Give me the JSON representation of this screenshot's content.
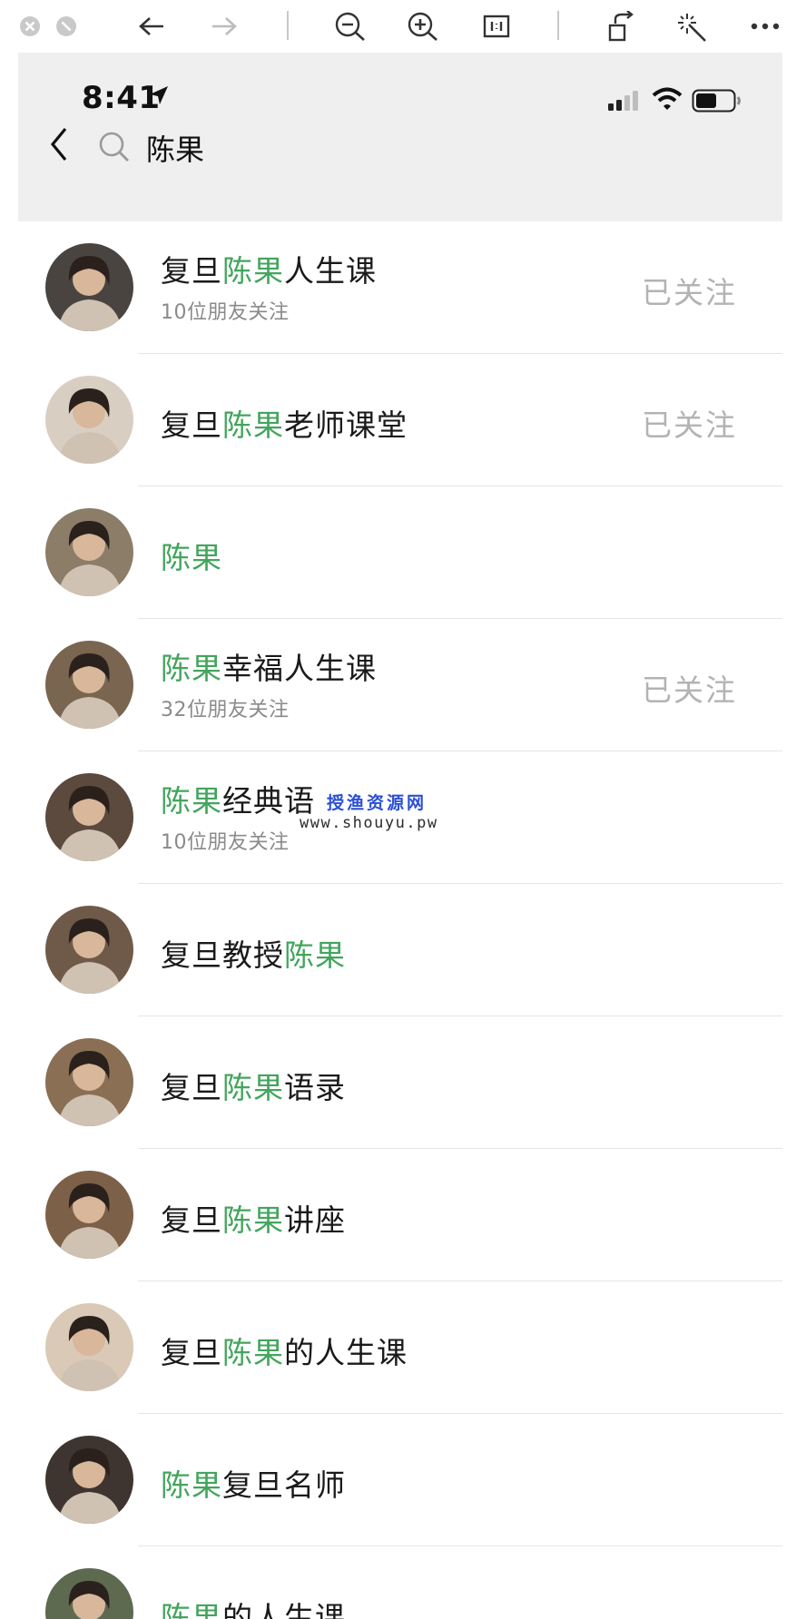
{
  "viewer_toolbar": {
    "icons": [
      "close-icon",
      "minimize-icon",
      "back-arrow-icon",
      "forward-arrow-icon",
      "zoom-out-icon",
      "zoom-in-icon",
      "actual-size-icon",
      "rotate-icon",
      "magic-wand-icon",
      "more-icon"
    ]
  },
  "status_bar": {
    "time": "8:41"
  },
  "search": {
    "query": "陈果"
  },
  "results": [
    {
      "pre": "复旦",
      "hl": "陈果",
      "post": "人生课",
      "sub": "10位朋友关注",
      "action": "已关注",
      "avatar_color": "#4a4440"
    },
    {
      "pre": "复旦",
      "hl": "陈果",
      "post": "老师课堂",
      "sub": "",
      "action": "已关注",
      "avatar_color": "#d8cfc2"
    },
    {
      "pre": "",
      "hl": "陈果",
      "post": "",
      "sub": "",
      "action": "",
      "avatar_color": "#8c7d68"
    },
    {
      "pre": "",
      "hl": "陈果",
      "post": "幸福人生课",
      "sub": "32位朋友关注",
      "action": "已关注",
      "avatar_color": "#7a6550"
    },
    {
      "pre": "",
      "hl": "陈果",
      "post": "经典语",
      "sub": "10位朋友关注",
      "action": "",
      "avatar_color": "#5b4a3d"
    },
    {
      "pre": "复旦教授",
      "hl": "陈果",
      "post": "",
      "sub": "",
      "action": "",
      "avatar_color": "#6f5a4a"
    },
    {
      "pre": "复旦",
      "hl": "陈果",
      "post": "语录",
      "sub": "",
      "action": "",
      "avatar_color": "#8a6f55"
    },
    {
      "pre": "复旦",
      "hl": "陈果",
      "post": "讲座",
      "sub": "",
      "action": "",
      "avatar_color": "#7d6048"
    },
    {
      "pre": "复旦",
      "hl": "陈果",
      "post": "的人生课",
      "sub": "",
      "action": "",
      "avatar_color": "#d9c9b6"
    },
    {
      "pre": "",
      "hl": "陈果",
      "post": "复旦名师",
      "sub": "",
      "action": "",
      "avatar_color": "#3f3530"
    },
    {
      "pre": "",
      "hl": "陈果",
      "post": "的人生课",
      "sub": "",
      "action": "",
      "avatar_color": "#5e6a50"
    }
  ],
  "watermark": {
    "title": "授渔资源网",
    "url": "www.shouyu.pw"
  },
  "colors": {
    "highlight": "#43a55d",
    "followed": "#b3b3b3",
    "background": "#efefef"
  }
}
